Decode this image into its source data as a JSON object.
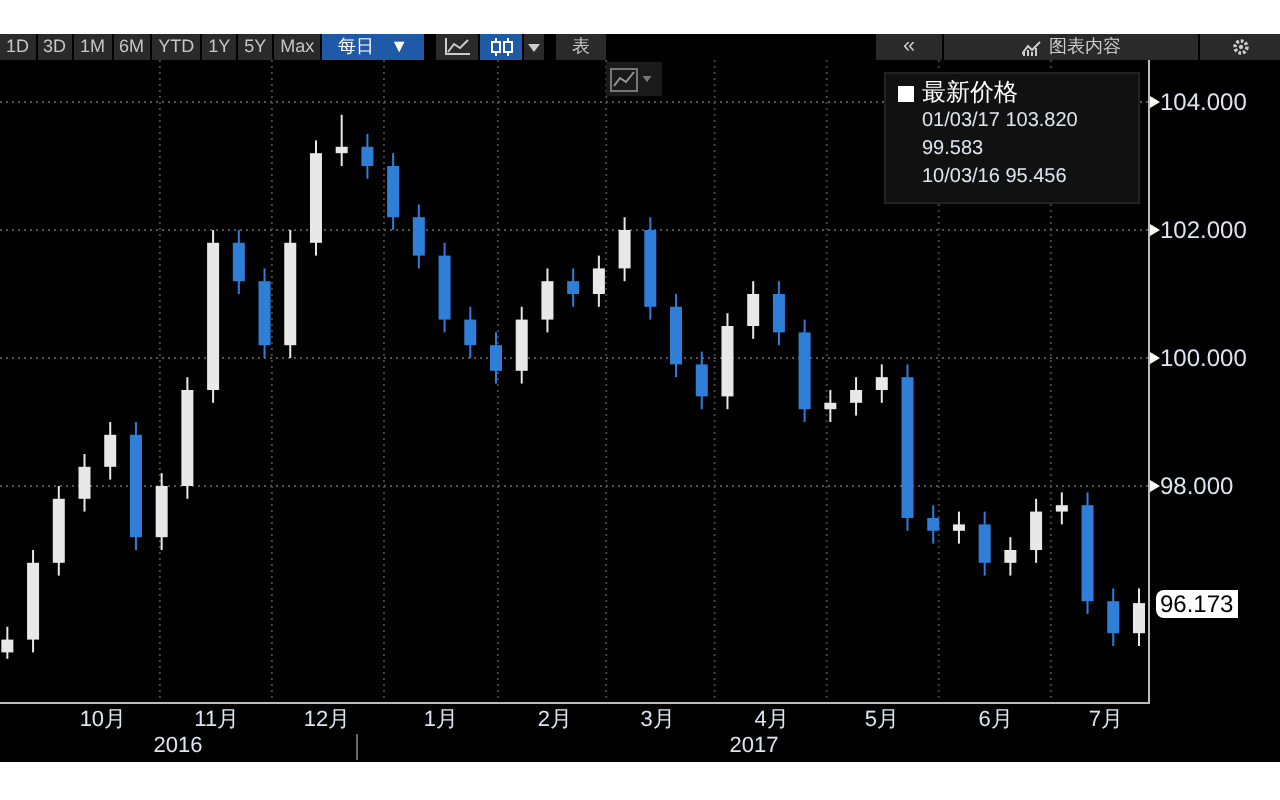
{
  "toolbar": {
    "ranges": [
      {
        "label": "1D",
        "selected": false
      },
      {
        "label": "3D",
        "selected": false
      },
      {
        "label": "1M",
        "selected": false
      },
      {
        "label": "6M",
        "selected": false
      },
      {
        "label": "YTD",
        "selected": false
      },
      {
        "label": "1Y",
        "selected": false
      },
      {
        "label": "5Y",
        "selected": false
      },
      {
        "label": "Max",
        "selected": false
      }
    ],
    "interval": {
      "label": "每日",
      "caret": "▼",
      "selected": true
    },
    "chart_types": [
      {
        "kind": "line",
        "selected": false
      },
      {
        "kind": "candle",
        "selected": true
      }
    ],
    "table_button": "表",
    "collapse_button": "«",
    "content_button": "图表内容"
  },
  "legend": {
    "title": "最新价格",
    "high": "01/03/17 103.820",
    "mid": "99.583",
    "low": "10/03/16 95.456"
  },
  "last_price": "96.173",
  "years": [
    "2016",
    "2017"
  ],
  "chart_data": {
    "type": "candlestick",
    "grid": true,
    "ylim": [
      94.625,
      104.656
    ],
    "xlim": [
      "2016-09-17",
      "2017-07-27"
    ],
    "x": [
      "2016-09-19",
      "2016-09-26",
      "2016-10-03",
      "2016-10-10",
      "2016-10-17",
      "2016-10-24",
      "2016-10-31",
      "2016-11-07",
      "2016-11-14",
      "2016-11-21",
      "2016-11-28",
      "2016-12-05",
      "2016-12-12",
      "2016-12-19",
      "2016-12-26",
      "2017-01-02",
      "2017-01-09",
      "2017-01-16",
      "2017-01-23",
      "2017-01-30",
      "2017-02-06",
      "2017-02-13",
      "2017-02-20",
      "2017-02-27",
      "2017-03-06",
      "2017-03-13",
      "2017-03-20",
      "2017-03-27",
      "2017-04-03",
      "2017-04-10",
      "2017-04-17",
      "2017-04-24",
      "2017-05-01",
      "2017-05-08",
      "2017-05-15",
      "2017-05-22",
      "2017-05-29",
      "2017-06-05",
      "2017-06-12",
      "2017-06-19",
      "2017-06-26",
      "2017-07-03",
      "2017-07-10",
      "2017-07-17",
      "2017-07-24"
    ],
    "xticks": [
      {
        "value": "2016-10-15",
        "label": "10月"
      },
      {
        "value": "2016-11-15",
        "label": "11月"
      },
      {
        "value": "2016-12-15",
        "label": "12月"
      },
      {
        "value": "2017-01-15",
        "label": "1月"
      },
      {
        "value": "2017-02-15",
        "label": "2月"
      },
      {
        "value": "2017-03-15",
        "label": "3月"
      },
      {
        "value": "2017-04-15",
        "label": "4月"
      },
      {
        "value": "2017-05-15",
        "label": "5月"
      },
      {
        "value": "2017-06-15",
        "label": "6月"
      },
      {
        "value": "2017-07-15",
        "label": "7月"
      }
    ],
    "ohlc": [
      [
        95.4,
        95.8,
        95.3,
        95.6
      ],
      [
        95.6,
        97.0,
        95.4,
        96.8
      ],
      [
        96.8,
        98.0,
        96.6,
        97.8
      ],
      [
        97.8,
        98.5,
        97.6,
        98.3
      ],
      [
        98.3,
        99.0,
        98.1,
        98.8
      ],
      [
        98.8,
        99.0,
        97.0,
        97.2
      ],
      [
        97.2,
        98.2,
        97.0,
        98.0
      ],
      [
        98.0,
        99.7,
        97.8,
        99.5
      ],
      [
        99.5,
        102.0,
        99.3,
        101.8
      ],
      [
        101.8,
        102.0,
        101.0,
        101.2
      ],
      [
        101.2,
        101.4,
        100.0,
        100.2
      ],
      [
        100.2,
        102.0,
        100.0,
        101.8
      ],
      [
        101.8,
        103.4,
        101.6,
        103.2
      ],
      [
        103.2,
        103.8,
        103.0,
        103.3
      ],
      [
        103.3,
        103.5,
        102.8,
        103.0
      ],
      [
        103.0,
        103.2,
        102.0,
        102.2
      ],
      [
        102.2,
        102.4,
        101.4,
        101.6
      ],
      [
        101.6,
        101.8,
        100.4,
        100.6
      ],
      [
        100.6,
        100.8,
        100.0,
        100.2
      ],
      [
        100.2,
        100.4,
        99.6,
        99.8
      ],
      [
        99.8,
        100.8,
        99.6,
        100.6
      ],
      [
        100.6,
        101.4,
        100.4,
        101.2
      ],
      [
        101.2,
        101.4,
        100.8,
        101.0
      ],
      [
        101.0,
        101.6,
        100.8,
        101.4
      ],
      [
        101.4,
        102.2,
        101.2,
        102.0
      ],
      [
        102.0,
        102.2,
        100.6,
        100.8
      ],
      [
        100.8,
        101.0,
        99.7,
        99.9
      ],
      [
        99.9,
        100.1,
        99.2,
        99.4
      ],
      [
        99.4,
        100.7,
        99.2,
        100.5
      ],
      [
        100.5,
        101.2,
        100.3,
        101.0
      ],
      [
        101.0,
        101.2,
        100.2,
        100.4
      ],
      [
        100.4,
        100.6,
        99.0,
        99.2
      ],
      [
        99.2,
        99.5,
        99.0,
        99.3
      ],
      [
        99.3,
        99.7,
        99.1,
        99.5
      ],
      [
        99.5,
        99.9,
        99.3,
        99.7
      ],
      [
        99.7,
        99.9,
        97.3,
        97.5
      ],
      [
        97.5,
        97.7,
        97.1,
        97.3
      ],
      [
        97.3,
        97.6,
        97.1,
        97.4
      ],
      [
        97.4,
        97.6,
        96.6,
        96.8
      ],
      [
        96.8,
        97.2,
        96.6,
        97.0
      ],
      [
        97.0,
        97.8,
        96.8,
        97.6
      ],
      [
        97.6,
        97.9,
        97.4,
        97.7
      ],
      [
        97.7,
        97.9,
        96.0,
        96.2
      ],
      [
        96.2,
        96.4,
        95.5,
        95.7
      ],
      [
        95.7,
        96.4,
        95.5,
        96.17
      ]
    ],
    "yticks": [
      {
        "value": 104,
        "label": "104.000"
      },
      {
        "value": 102,
        "label": "102.000"
      },
      {
        "value": 100,
        "label": "100.000"
      },
      {
        "value": 98,
        "label": "98.000"
      }
    ]
  }
}
